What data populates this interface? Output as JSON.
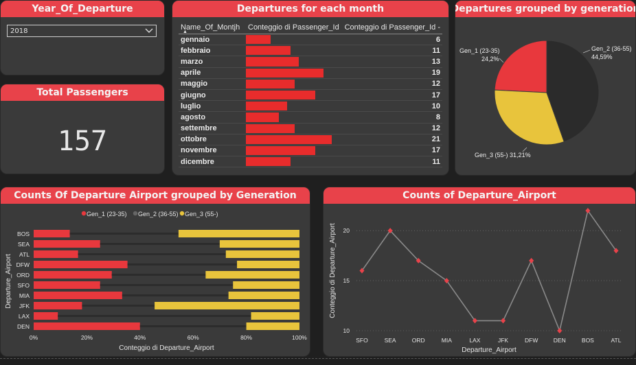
{
  "year_card": {
    "title": "Year_Of_Departure",
    "selected": "2018"
  },
  "total_card": {
    "title": "Total Passengers",
    "value": "157"
  },
  "month_card": {
    "title": "Departures for each month",
    "columns": [
      "Name_Of_Montjh",
      "Conteggio di Passenger_Id",
      "Conteggio di Passenger_Id -"
    ],
    "rows": [
      {
        "month": "gennaio",
        "value": 6
      },
      {
        "month": "febbraio",
        "value": 11
      },
      {
        "month": "marzo",
        "value": 13
      },
      {
        "month": "aprile",
        "value": 19
      },
      {
        "month": "maggio",
        "value": 12
      },
      {
        "month": "giugno",
        "value": 17
      },
      {
        "month": "luglio",
        "value": 10
      },
      {
        "month": "agosto",
        "value": 8
      },
      {
        "month": "settembre",
        "value": 12
      },
      {
        "month": "ottobre",
        "value": 21
      },
      {
        "month": "novembre",
        "value": 17
      },
      {
        "month": "dicembre",
        "value": 11
      }
    ]
  },
  "pie_card": {
    "title": "Departures grouped by generation"
  },
  "stacked_card": {
    "title": "Counts Of Departure Airport grouped by Generation"
  },
  "line_card": {
    "title": "Counts of Departure_Airport"
  },
  "colors": {
    "gen1": "#e8383d",
    "gen2": "#2b2b2b",
    "gen3": "#e8c43c",
    "header": "#e8424a",
    "line": "#8a8a8a",
    "marker": "#e8424a"
  },
  "chart_data": [
    {
      "type": "pie",
      "slices": [
        {
          "label": "Gen_1 (23-35)",
          "value": 24.2,
          "text": "24,2%"
        },
        {
          "label": "Gen_2 (36-55)",
          "value": 44.59,
          "text": "44,59%"
        },
        {
          "label": "Gen_3 (55-)",
          "value": 31.21,
          "text": "31,21%"
        }
      ]
    },
    {
      "type": "bar",
      "orientation": "horizontal-stacked-100",
      "legend": [
        "Gen_1 (23-35)",
        "Gen_2 (36-55)",
        "Gen_3 (55-)"
      ],
      "legend_position": "top",
      "categories": [
        "BOS",
        "SEA",
        "ATL",
        "DFW",
        "ORD",
        "SFO",
        "MIA",
        "JFK",
        "LAX",
        "DEN"
      ],
      "series": [
        {
          "name": "Gen_1 (23-35)",
          "values": [
            13.6,
            25,
            16.7,
            35.3,
            29.4,
            25,
            33.3,
            18.2,
            9.1,
            40
          ]
        },
        {
          "name": "Gen_2 (36-55)",
          "values": [
            40.9,
            45,
            55.6,
            41.2,
            35.3,
            50,
            40,
            27.3,
            72.7,
            40
          ]
        },
        {
          "name": "Gen_3 (55-)",
          "values": [
            45.5,
            30,
            27.7,
            23.5,
            35.3,
            25,
            26.7,
            54.5,
            18.2,
            20
          ]
        }
      ],
      "xlabel": "Conteggio di Departure_Airport",
      "ylabel": "Departure_Airport",
      "xticks": [
        "0%",
        "20%",
        "40%",
        "60%",
        "80%",
        "100%"
      ],
      "xlim": [
        0,
        100
      ]
    },
    {
      "type": "line",
      "categories": [
        "SFO",
        "SEA",
        "ORD",
        "MIA",
        "LAX",
        "JFK",
        "DFW",
        "DEN",
        "BOS",
        "ATL"
      ],
      "values": [
        16,
        20,
        17,
        15,
        11,
        11,
        17,
        10,
        22,
        18
      ],
      "xlabel": "Departure_Airport",
      "ylabel": "Conteggio di Departure_Airport",
      "yticks": [
        10,
        15,
        20
      ],
      "ylim": [
        10,
        22
      ],
      "grid": true
    }
  ]
}
